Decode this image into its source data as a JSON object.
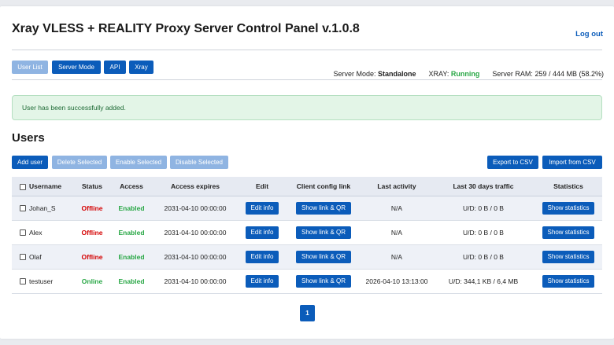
{
  "header": {
    "title": "Xray VLESS + REALITY Proxy Server Control Panel v.1.0.8",
    "logout": "Log out"
  },
  "nav": {
    "user_list": "User List",
    "server_mode": "Server Mode",
    "api": "API",
    "xray": "Xray"
  },
  "server_status": {
    "mode_label": "Server Mode:",
    "mode_value": "Standalone",
    "xray_label": "XRAY:",
    "xray_value": "Running",
    "ram_label": "Server RAM:",
    "ram_value": "259 / 444 MB (58.2%)"
  },
  "alert": {
    "message": "User has been successfully added."
  },
  "users": {
    "heading": "Users",
    "actions": {
      "add_user": "Add user",
      "delete_selected": "Delete Selected",
      "enable_selected": "Enable Selected",
      "disable_selected": "Disable Selected",
      "export_csv": "Export to CSV",
      "import_csv": "Import from CSV"
    },
    "columns": [
      "Username",
      "Status",
      "Access",
      "Access expires",
      "Edit",
      "Client config link",
      "Last activity",
      "Last 30 days traffic",
      "Statistics"
    ],
    "rows": [
      {
        "username": "Johan_S",
        "status": "Offline",
        "access": "Enabled",
        "expires": "2031-04-10 00:00:00",
        "edit": "Edit info",
        "link": "Show link & QR",
        "last_activity": "N/A",
        "traffic": "U/D: 0 B / 0 B",
        "stats": "Show statistics"
      },
      {
        "username": "Alex",
        "status": "Offline",
        "access": "Enabled",
        "expires": "2031-04-10 00:00:00",
        "edit": "Edit info",
        "link": "Show link & QR",
        "last_activity": "N/A",
        "traffic": "U/D: 0 B / 0 B",
        "stats": "Show statistics"
      },
      {
        "username": "Olaf",
        "status": "Offline",
        "access": "Enabled",
        "expires": "2031-04-10 00:00:00",
        "edit": "Edit info",
        "link": "Show link & QR",
        "last_activity": "N/A",
        "traffic": "U/D: 0 B / 0 B",
        "stats": "Show statistics"
      },
      {
        "username": "testuser",
        "status": "Online",
        "access": "Enabled",
        "expires": "2031-04-10 00:00:00",
        "edit": "Edit info",
        "link": "Show link & QR",
        "last_activity": "2026-04-10 13:13:00",
        "traffic": "U/D: 344,1 KB / 6,4 MB",
        "stats": "Show statistics"
      }
    ]
  },
  "pagination": {
    "current": "1"
  },
  "colors": {
    "primary": "#0b5cba",
    "online": "#28a745",
    "offline": "#d40000"
  }
}
